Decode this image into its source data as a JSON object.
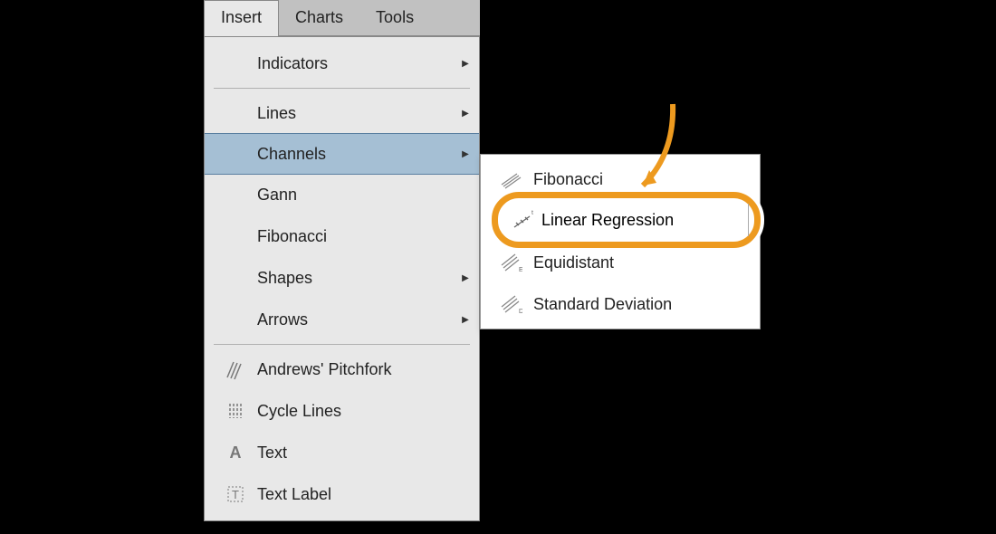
{
  "menubar": {
    "items": [
      {
        "label": "Insert",
        "active": true
      },
      {
        "label": "Charts",
        "active": false
      },
      {
        "label": "Tools",
        "active": false
      }
    ]
  },
  "dropdown": {
    "items": [
      {
        "label": "Indicators",
        "has_submenu": true
      },
      {
        "type": "separator"
      },
      {
        "label": "Lines",
        "has_submenu": true
      },
      {
        "label": "Channels",
        "has_submenu": true,
        "highlighted": true
      },
      {
        "label": "Gann",
        "has_submenu": false
      },
      {
        "label": "Fibonacci",
        "has_submenu": false
      },
      {
        "label": "Shapes",
        "has_submenu": true
      },
      {
        "label": "Arrows",
        "has_submenu": true
      },
      {
        "type": "separator"
      },
      {
        "label": "Andrews' Pitchfork",
        "icon": "diagonal-lines"
      },
      {
        "label": "Cycle Lines",
        "icon": "vertical-lines"
      },
      {
        "label": "Text",
        "icon": "letter-a"
      },
      {
        "label": "Text Label",
        "icon": "boxed-t"
      }
    ]
  },
  "submenu": {
    "items": [
      {
        "label": "Fibonacci",
        "icon": "channel-lines"
      },
      {
        "label": "Linear Regression",
        "icon": "regression",
        "callout": true
      },
      {
        "label": "Equidistant",
        "icon": "channel-e"
      },
      {
        "label": "Standard Deviation",
        "icon": "channel-d"
      }
    ]
  }
}
